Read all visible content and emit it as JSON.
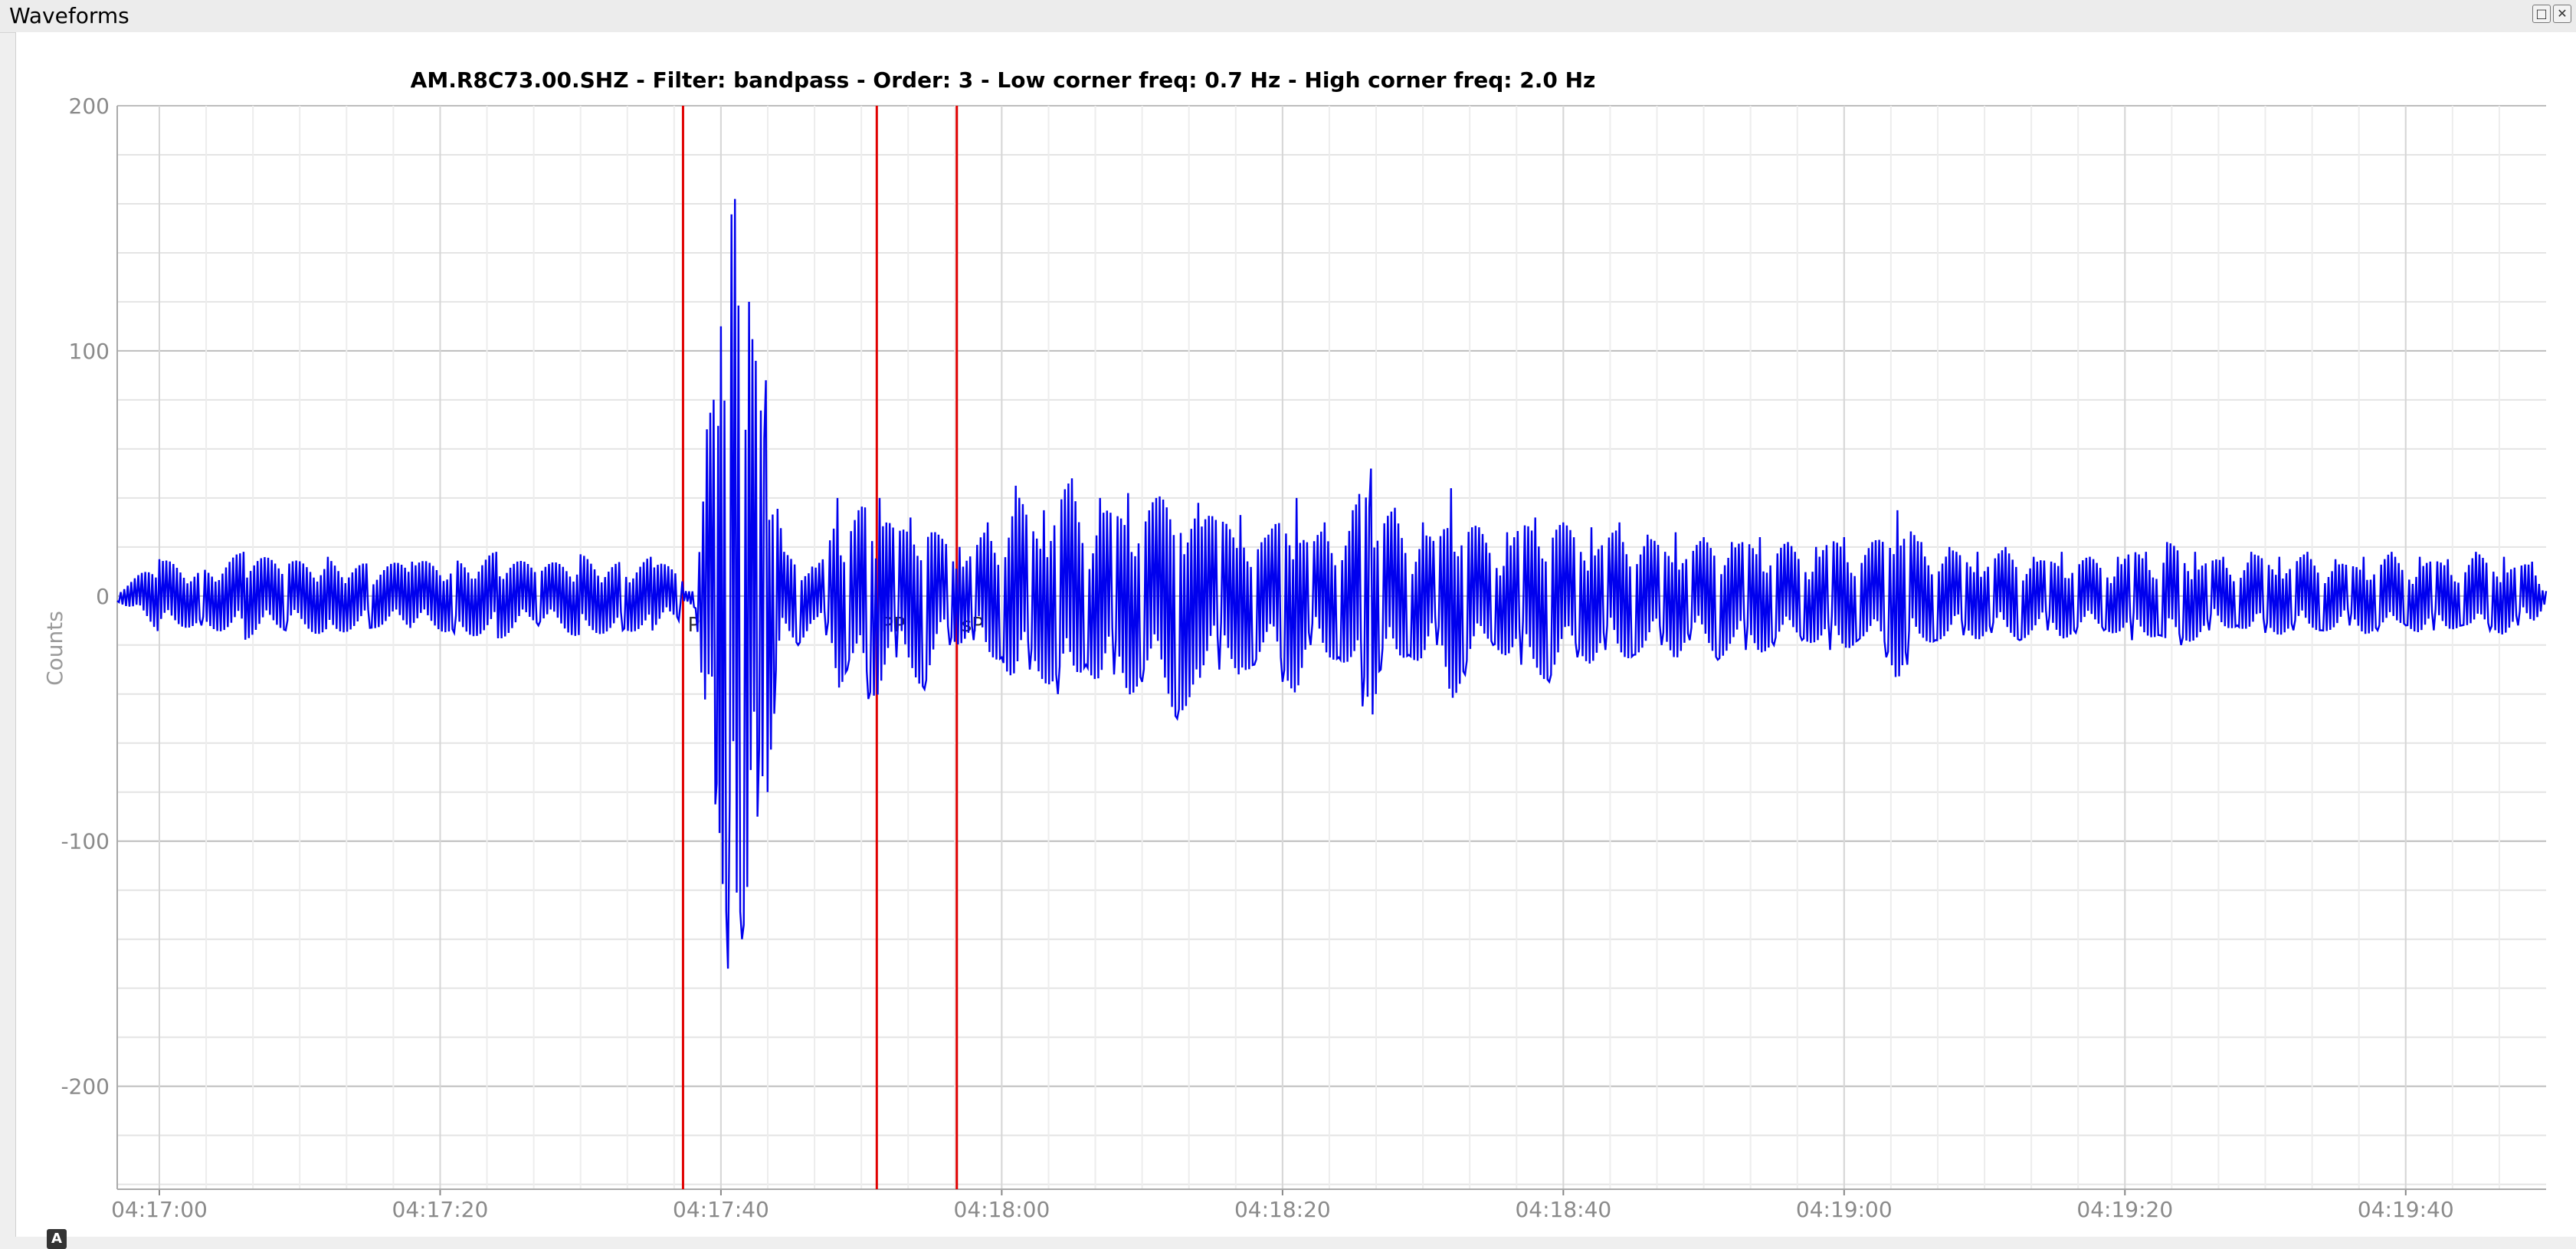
{
  "window": {
    "title": "Waveforms",
    "buttons": [
      "float",
      "close"
    ]
  },
  "chart_data": {
    "type": "line",
    "title": "AM.R8C73.00.SHZ - Filter: bandpass - Order: 3 - Low corner freq: 0.7 Hz - High corner freq: 2.0 Hz",
    "ylabel": "Counts",
    "xlabel": "",
    "ylim": [
      -242,
      200
    ],
    "y_ticks": [
      200,
      100,
      0,
      -100,
      -200
    ],
    "x_range_seconds_after_04_16_57": [
      0,
      173
    ],
    "x_ticks": [
      "04:17:00",
      "04:17:20",
      "04:17:40",
      "04:18:00",
      "04:18:20",
      "04:18:40",
      "04:19:00",
      "04:19:20",
      "04:19:40"
    ],
    "grid": true,
    "series": [
      {
        "color": "#0000ee",
        "points": [
          [
            0,
            -2
          ],
          [
            3,
            15
          ],
          [
            6,
            -12
          ],
          [
            9,
            18
          ],
          [
            12,
            -14
          ],
          [
            15,
            16
          ],
          [
            18,
            -13
          ],
          [
            21,
            14
          ],
          [
            24,
            -15
          ],
          [
            27,
            18
          ],
          [
            30,
            -12
          ],
          [
            33,
            17
          ],
          [
            36,
            -14
          ],
          [
            38,
            16
          ],
          [
            40,
            -10
          ],
          [
            40.5,
            2
          ],
          [
            41.2,
            -5
          ],
          [
            42.0,
            68
          ],
          [
            42.6,
            -85
          ],
          [
            43.0,
            110
          ],
          [
            43.5,
            -152
          ],
          [
            44.0,
            162
          ],
          [
            44.5,
            -140
          ],
          [
            45.0,
            120
          ],
          [
            45.6,
            -90
          ],
          [
            46.2,
            88
          ],
          [
            46.8,
            -48
          ],
          [
            47.5,
            18
          ],
          [
            48.5,
            -20
          ],
          [
            49.5,
            12
          ],
          [
            50.5,
            -16
          ],
          [
            51.3,
            40
          ],
          [
            52.0,
            -30
          ],
          [
            52.8,
            35
          ],
          [
            53.5,
            -42
          ],
          [
            54.3,
            40
          ],
          [
            55.5,
            -25
          ],
          [
            56.5,
            32
          ],
          [
            57.5,
            -38
          ],
          [
            58.5,
            25
          ],
          [
            59.3,
            -20
          ],
          [
            60.0,
            20
          ],
          [
            61.0,
            -18
          ],
          [
            62.0,
            30
          ],
          [
            63.0,
            -25
          ],
          [
            64.0,
            45
          ],
          [
            65.0,
            -30
          ],
          [
            66.0,
            35
          ],
          [
            67.0,
            -40
          ],
          [
            68.0,
            48
          ],
          [
            69.0,
            -28
          ],
          [
            70.0,
            40
          ],
          [
            71.0,
            -32
          ],
          [
            72.0,
            42
          ],
          [
            73.0,
            -35
          ],
          [
            74.0,
            40
          ],
          [
            75.5,
            -50
          ],
          [
            77.0,
            38
          ],
          [
            78.5,
            -30
          ],
          [
            80.0,
            33
          ],
          [
            81.0,
            -28
          ],
          [
            82.0,
            25
          ],
          [
            83.0,
            -35
          ],
          [
            84.0,
            40
          ],
          [
            85.0,
            -20
          ],
          [
            86.0,
            30
          ],
          [
            87.0,
            -25
          ],
          [
            88.0,
            35
          ],
          [
            88.7,
            -45
          ],
          [
            89.3,
            52
          ],
          [
            90.0,
            -30
          ],
          [
            91.0,
            36
          ],
          [
            92.0,
            -24
          ],
          [
            93.0,
            30
          ],
          [
            94.0,
            -20
          ],
          [
            95.0,
            44
          ],
          [
            96.0,
            -32
          ],
          [
            97.0,
            28
          ],
          [
            98.0,
            -20
          ],
          [
            99.0,
            26
          ],
          [
            100.0,
            -28
          ],
          [
            101.0,
            32
          ],
          [
            102.0,
            -35
          ],
          [
            103.0,
            30
          ],
          [
            104.0,
            -25
          ],
          [
            105.0,
            28
          ],
          [
            106.0,
            -22
          ],
          [
            107.0,
            30
          ],
          [
            108.0,
            -24
          ],
          [
            109.0,
            25
          ],
          [
            110.0,
            -20
          ],
          [
            111.0,
            26
          ],
          [
            112.0,
            -18
          ],
          [
            113.0,
            24
          ],
          [
            114.0,
            -26
          ],
          [
            115.0,
            22
          ],
          [
            116.0,
            -22
          ],
          [
            117.0,
            24
          ],
          [
            118.0,
            -20
          ],
          [
            119.0,
            22
          ],
          [
            120.0,
            -18
          ],
          [
            121.0,
            20
          ],
          [
            122.0,
            -22
          ],
          [
            123.0,
            24
          ],
          [
            124.0,
            -18
          ],
          [
            125.0,
            22
          ],
          [
            126.0,
            -25
          ],
          [
            126.8,
            35
          ],
          [
            127.5,
            -28
          ],
          [
            128.5,
            22
          ],
          [
            129.5,
            -18
          ],
          [
            130.5,
            20
          ],
          [
            131.5,
            -16
          ],
          [
            132.5,
            18
          ],
          [
            133.5,
            -15
          ],
          [
            134.5,
            20
          ],
          [
            135.5,
            -18
          ],
          [
            136.5,
            16
          ],
          [
            137.5,
            -14
          ],
          [
            138.5,
            18
          ],
          [
            139.5,
            -15
          ],
          [
            140.5,
            16
          ],
          [
            141.5,
            -14
          ],
          [
            142.5,
            16
          ],
          [
            143.5,
            -18
          ],
          [
            144.5,
            18
          ],
          [
            145.5,
            -16
          ],
          [
            146.0,
            22
          ],
          [
            147.0,
            -20
          ],
          [
            148.0,
            18
          ],
          [
            149.0,
            -14
          ],
          [
            150.0,
            16
          ],
          [
            151.0,
            -12
          ],
          [
            152.0,
            18
          ],
          [
            153.0,
            -15
          ],
          [
            154.0,
            16
          ],
          [
            155.0,
            -14
          ],
          [
            156.0,
            18
          ],
          [
            157.0,
            -14
          ],
          [
            158.0,
            15
          ],
          [
            159.0,
            -12
          ],
          [
            160.0,
            16
          ],
          [
            161.0,
            -14
          ],
          [
            162.0,
            18
          ],
          [
            163.0,
            -12
          ],
          [
            164.0,
            16
          ],
          [
            165.0,
            -14
          ],
          [
            166.0,
            15
          ],
          [
            167.0,
            -12
          ],
          [
            168.0,
            18
          ],
          [
            169.0,
            -14
          ],
          [
            170.0,
            16
          ],
          [
            171.0,
            -12
          ],
          [
            172.0,
            14
          ],
          [
            173.0,
            2
          ]
        ]
      }
    ],
    "markers": [
      {
        "label": "P",
        "x": 40.3,
        "color": "#e00000"
      },
      {
        "label": "PP",
        "x": 54.1,
        "color": "#e00000"
      },
      {
        "label": "sP",
        "x": 59.8,
        "color": "#e00000"
      }
    ]
  },
  "toolbar": {
    "axis_badge": "A"
  }
}
